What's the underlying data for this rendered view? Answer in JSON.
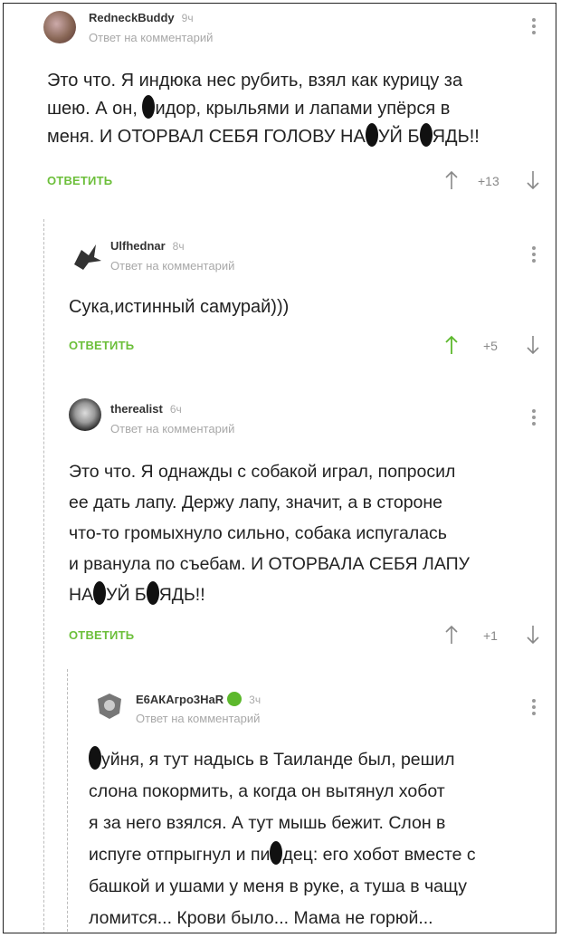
{
  "reply_hint": "Ответ на комментарий",
  "comments": [
    {
      "author": "RedneckBuddy",
      "time": "9ч",
      "lines": [
        "Это что. Я индюка нес рубить, взял как курицу за",
        "шею. А он, ",
        "идор, крыльями и лапами упёрся в",
        "меня. И ОТОРВАЛ СЕБЯ ГОЛОВУ НА",
        "УЙ Б",
        "ЯДЬ!!"
      ],
      "reply_label": "ОТВЕТИТЬ",
      "votes": "+13"
    },
    {
      "author": "Ulfhednar",
      "time": "8ч",
      "lines": [
        "Сука,истинный самурай)))"
      ],
      "reply_label": "ОТВЕТИТЬ",
      "votes": "+5"
    },
    {
      "author": "therealist",
      "time": "6ч",
      "lines": [
        "Это что. Я однажды с собакой играл, попросил",
        "ее дать лапу. Держу лапу, значит, а в стороне",
        "что-то громыхнуло сильно, собака испугалась",
        "и рванула по съебам. И ОТОРВАЛА СЕБЯ ЛАПУ",
        "НА",
        "УЙ Б",
        "ЯДЬ!!"
      ],
      "reply_label": "ОТВЕТИТЬ",
      "votes": "+1"
    },
    {
      "author": "Е6АКАгро3НаR",
      "time": "3ч",
      "lines": [
        "уйня, я тут надысь в Таиланде был, решил",
        "слона покормить, а когда он вытянул хобот",
        "я за него взялся. А тут мышь бежит. Слон в",
        "испуге отпрыгнул и пи",
        "дец: его хобот вместе с",
        "башкой и ушами у меня в руке, а туша в чащу",
        "ломится... Крови было... Мама не горюй..."
      ]
    }
  ],
  "colors": {
    "reply": "#6cbf3a",
    "upvote_active": "#5cb82c",
    "verified": "#5cb82c"
  }
}
